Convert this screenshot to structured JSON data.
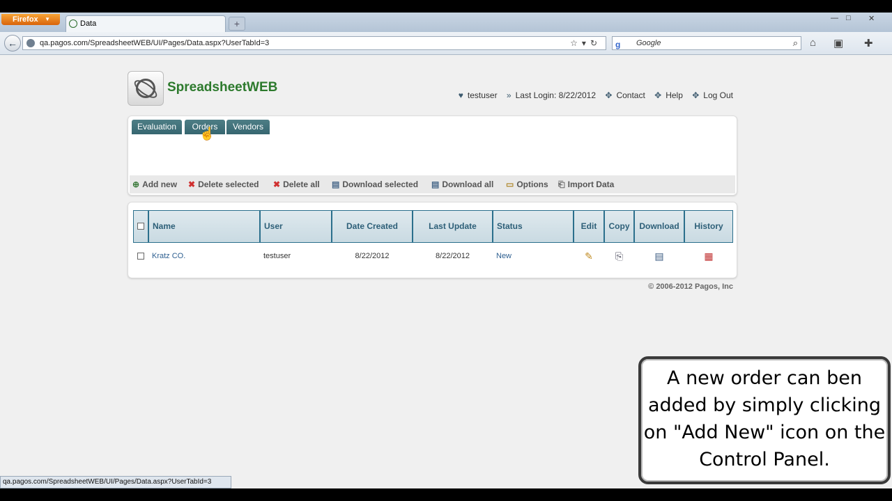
{
  "browser": {
    "menu_button": "Firefox",
    "tab_title": "Data",
    "url": "qa.pagos.com/SpreadsheetWEB/UI/Pages/Data.aspx?UserTabId=3",
    "search_engine": "Google",
    "status_url": "qa.pagos.com/SpreadsheetWEB/UI/Pages/Data.aspx?UserTabId=3"
  },
  "header": {
    "brand": "SpreadsheetWEB",
    "user": "testuser",
    "last_login": "Last Login: 8/22/2012",
    "contact": "Contact",
    "help": "Help",
    "logout": "Log Out"
  },
  "tabs": [
    {
      "label": "Evaluation"
    },
    {
      "label": "Orders"
    },
    {
      "label": "Vendors"
    }
  ],
  "toolbar": {
    "add_new": "Add new",
    "delete_selected": "Delete selected",
    "delete_all": "Delete all",
    "download_selected": "Download selected",
    "download_all": "Download all",
    "options": "Options",
    "import_data": "Import Data"
  },
  "table": {
    "headers": {
      "name": "Name",
      "user": "User",
      "date_created": "Date Created",
      "last_update": "Last Update",
      "status": "Status",
      "edit": "Edit",
      "copy": "Copy",
      "download": "Download",
      "history": "History"
    },
    "rows": [
      {
        "name": "Kratz CO.",
        "user": "testuser",
        "date_created": "8/22/2012",
        "last_update": "8/22/2012",
        "status": "New"
      }
    ]
  },
  "footer": {
    "copyright": "© 2006-2012 Pagos, Inc"
  },
  "callout": {
    "text": "A new order can ben added by simply clicking on \"Add New\" icon on the Control Panel."
  },
  "colors": {
    "brand_green": "#2d7a2d",
    "tab_teal": "#3f6f78",
    "header_blue": "#2d5f78"
  }
}
